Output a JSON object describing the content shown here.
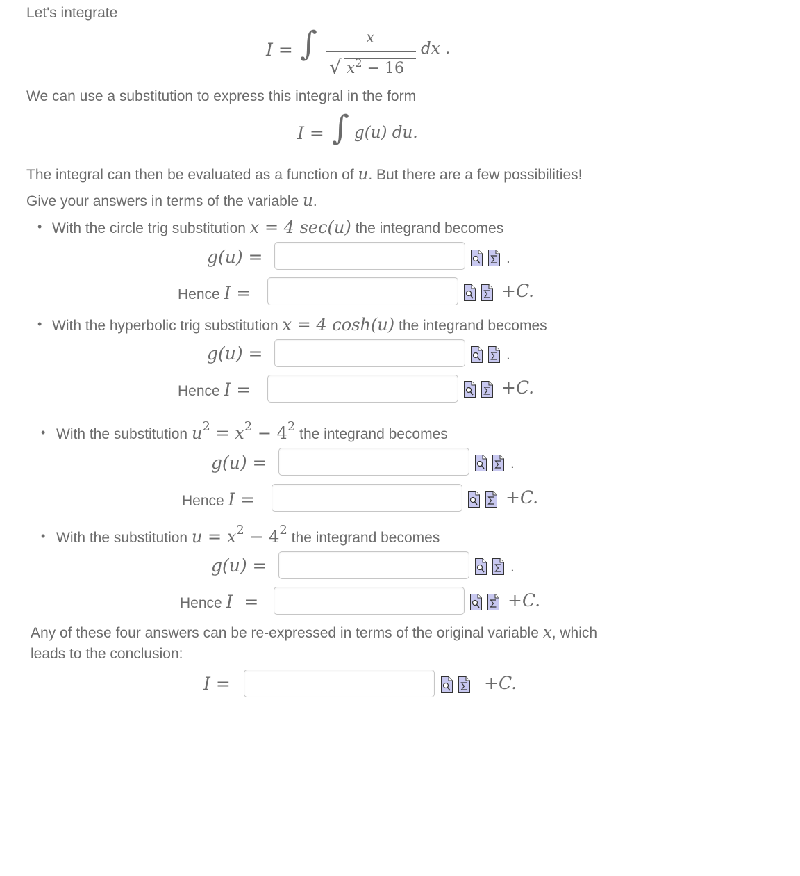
{
  "intro": {
    "lead": "Let's integrate",
    "integral_lhs": "I =",
    "integral_sign": "∫",
    "numerator": "x",
    "sqrt_sign": "√",
    "denominator_var": "x",
    "denominator_exp": "2",
    "denominator_rest": " − 16",
    "dx": "dx .",
    "substitution_text": "We can use a substitution to express this integral in the form",
    "form_lhs": "I =",
    "form_sign": "∫",
    "form_rhs": "g(u) du.",
    "possibilities_text_a": "The integral can then be evaluated as a function of ",
    "possibilities_var": "u",
    "possibilities_text_b": ". But there are a few possibilities!",
    "give_text": "Give your answers in terms of the variable ",
    "give_var": "u",
    "give_end": "."
  },
  "labels": {
    "g_label": "g(u) =",
    "hence_text": "Hence ",
    "hence_var": "I",
    "hence_eq": " =",
    "period": ".",
    "plus_c": "+C.",
    "bullet": "•"
  },
  "icons": {
    "preview": "preview-icon",
    "equation_editor": "equation-editor-icon",
    "icon_color": "#c8c8f0"
  },
  "parts": [
    {
      "pre": "With the circle trig substitution ",
      "math": "x = 4 sec(u)",
      "post": " the integrand becomes",
      "g_value": "",
      "i_value": ""
    },
    {
      "pre": "With the hyperbolic trig substitution ",
      "math": "x = 4 cosh(u)",
      "post": " the integrand becomes",
      "g_value": "",
      "i_value": ""
    },
    {
      "pre": "With the substitution ",
      "math_a": "u",
      "math_a_sup": "2",
      "math_b": " = x",
      "math_b_sup": "2",
      "math_c": " − 4",
      "math_c_sup": "2",
      "post": " the integrand becomes",
      "g_value": "",
      "i_value": ""
    },
    {
      "pre": "With the substitution ",
      "math_a": "u = x",
      "math_a_sup": "2",
      "math_c": " − 4",
      "math_c_sup": "2",
      "post": " the integrand becomes",
      "g_value": "",
      "i_value": ""
    }
  ],
  "conclusion": {
    "text_a": "Any of these four answers can be re-expressed in terms of the original variable ",
    "text_var": "x",
    "text_b": ", which",
    "text_line2": "leads to the conclusion:",
    "lhs": "I =",
    "value": "",
    "plus_c": "+C."
  },
  "colors": {
    "text": "#6b6b6b",
    "box_border": "#c6c6c6",
    "icon_fill": "#c8c8f0",
    "icon_stroke": "#333333"
  }
}
